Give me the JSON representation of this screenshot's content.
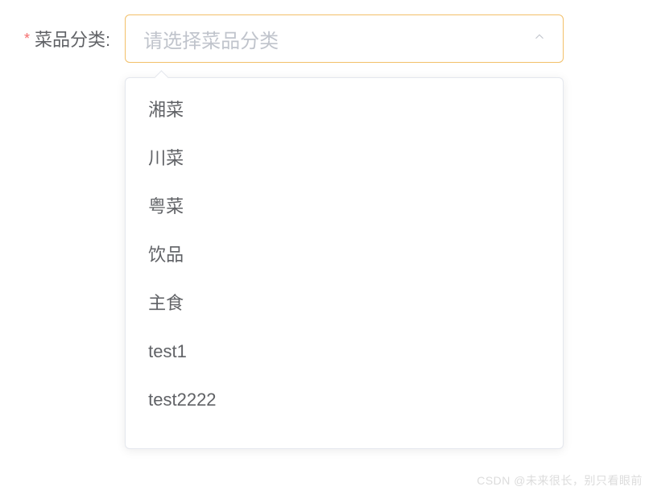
{
  "form": {
    "required_mark": "*",
    "label": "菜品分类:",
    "placeholder": "请选择菜品分类"
  },
  "options": [
    "湘菜",
    "川菜",
    "粤菜",
    "饮品",
    "主食",
    "test1",
    "test2222"
  ],
  "watermark": "CSDN @未来很长，别只看眼前"
}
